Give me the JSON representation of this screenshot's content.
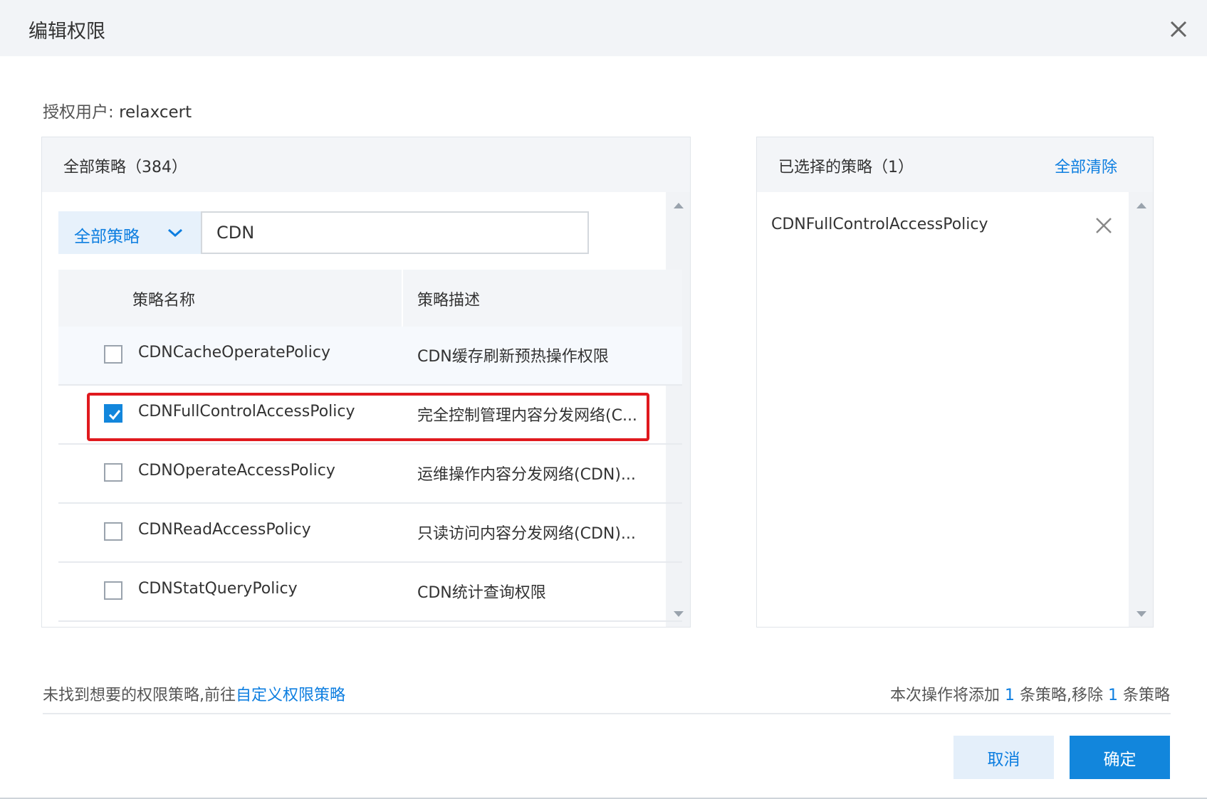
{
  "dialog": {
    "title": "编辑权限"
  },
  "auth_user": {
    "label": "授权用户: ",
    "value": "relaxcert"
  },
  "all_policies": {
    "title": "全部策略（384）",
    "filter": {
      "selected": "全部策略"
    },
    "search": {
      "value": "CDN"
    },
    "columns": [
      "策略名称",
      "策略描述"
    ],
    "rows": [
      {
        "name": "CDNCacheOperatePolicy",
        "desc": "CDN缓存刷新预热操作权限",
        "checked": false
      },
      {
        "name": "CDNFullControlAccessPolicy",
        "desc": "完全控制管理内容分发网络(C...",
        "checked": true
      },
      {
        "name": "CDNOperateAccessPolicy",
        "desc": "运维操作内容分发网络(CDN)...",
        "checked": false
      },
      {
        "name": "CDNReadAccessPolicy",
        "desc": "只读访问内容分发网络(CDN)...",
        "checked": false
      },
      {
        "name": "CDNStatQueryPolicy",
        "desc": "CDN统计查询权限",
        "checked": false
      }
    ]
  },
  "selected_policies": {
    "title": "已选择的策略（1）",
    "clear_all": "全部清除",
    "items": [
      "CDNFullControlAccessPolicy"
    ]
  },
  "footer": {
    "note": "未找到想要的权限策略,前往",
    "note_link": "自定义权限策略",
    "summary_prefix": "本次操作将添加 ",
    "add_count": "1",
    "summary_mid": " 条策略,移除 ",
    "remove_count": "1",
    "summary_suffix": " 条策略"
  },
  "buttons": {
    "cancel": "取消",
    "ok": "确定"
  },
  "colors": {
    "accent": "#1286dc",
    "highlight": "#e0191e",
    "header_bg": "#f2f4f7"
  },
  "icons": {
    "close": "close-icon",
    "dropdown": "chevron-down-icon",
    "remove": "close-icon",
    "check": "check-icon"
  }
}
